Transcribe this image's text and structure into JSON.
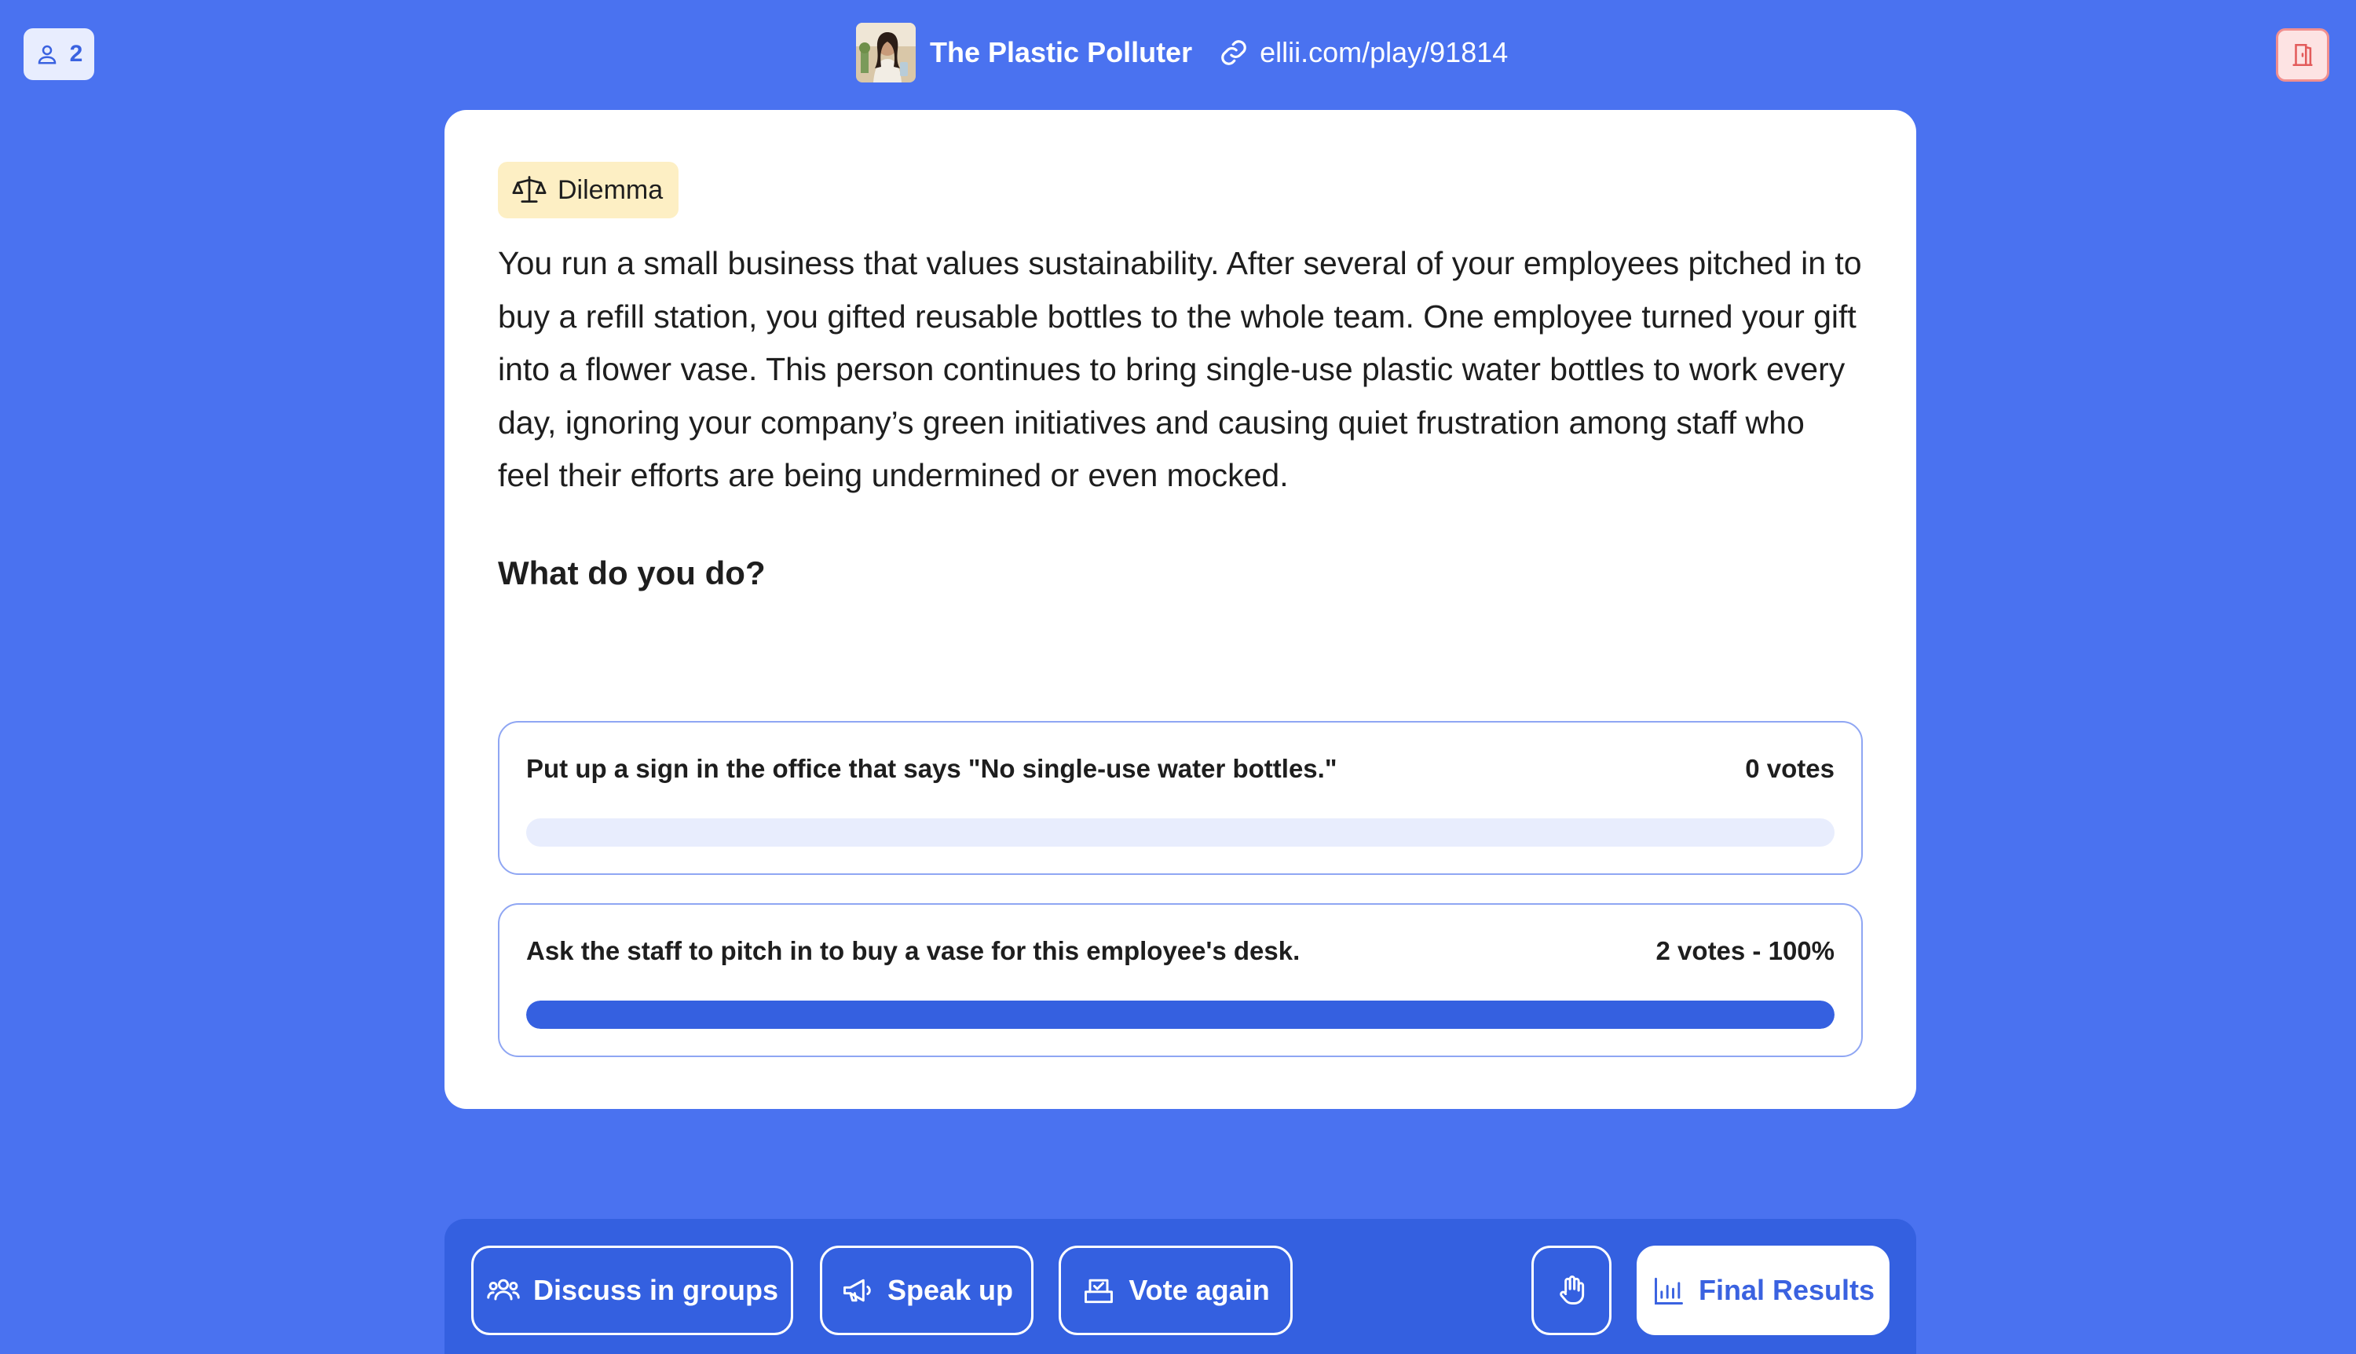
{
  "header": {
    "participant_count": "2",
    "activity_title": "The Plastic Polluter",
    "play_link": "ellii.com/play/91814"
  },
  "card": {
    "tag_label": "Dilemma",
    "dilemma_text": "You run a small business that values sustainability. After several of your employees pitched in to buy a refill station, you gifted reusable bottles to the whole team. One employee turned your gift into a flower vase. This person continues to bring single-use plastic water bottles to work every day, ignoring your company’s green initiatives and causing quiet frustration among staff who feel their efforts are being undermined or even mocked.",
    "question": "What do you do?",
    "options": [
      {
        "text": "Put up a sign in the office that says \"No single-use water bottles.\"",
        "result": "0 votes",
        "percent": 0
      },
      {
        "text": "Ask the staff to pitch in to buy a vase for this employee's desk.",
        "result": "2 votes - 100%",
        "percent": 100
      }
    ]
  },
  "toolbar": {
    "discuss_label": "Discuss in groups",
    "speak_label": "Speak up",
    "vote_label": "Vote again",
    "final_label": "Final Results"
  },
  "colors": {
    "background": "#4a72f0",
    "toolbar": "#3460e0",
    "accent": "#3560e0",
    "tag_bg": "#fdefc4",
    "exit_bg": "#fde3e3"
  },
  "icons": {
    "participants": "user-icon",
    "link": "link-icon",
    "exit": "exit-door-icon",
    "tag": "scales-icon",
    "discuss": "group-icon",
    "speak": "megaphone-icon",
    "vote": "ballot-box-icon",
    "raise_hand": "hand-icon",
    "final": "bar-chart-icon"
  }
}
